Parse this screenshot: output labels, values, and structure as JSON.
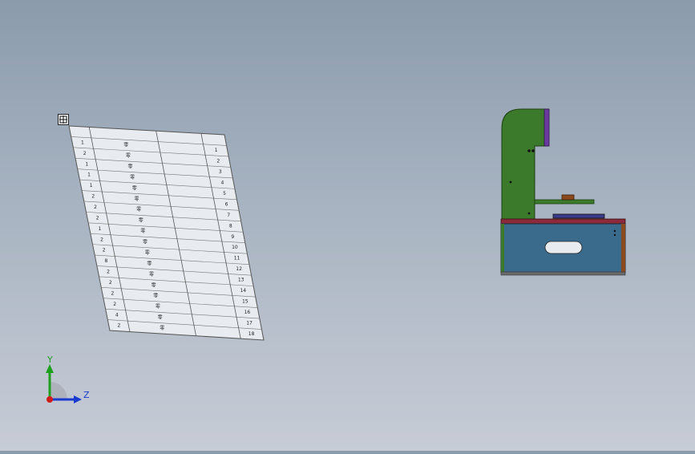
{
  "viewport": {
    "background_top": "#8b9bac",
    "background_bottom": "#c7ccd6"
  },
  "bom_table": {
    "header": [
      "",
      "",
      "",
      ""
    ],
    "rows": [
      [
        "1",
        "零",
        "",
        "1"
      ],
      [
        "2",
        "零",
        "",
        "2"
      ],
      [
        "1",
        "零",
        "",
        "3"
      ],
      [
        "1",
        "零",
        "",
        "4"
      ],
      [
        "1",
        "零",
        "",
        "5"
      ],
      [
        "2",
        "零",
        "",
        "6"
      ],
      [
        "2",
        "零",
        "",
        "7"
      ],
      [
        "2",
        "零",
        "",
        "8"
      ],
      [
        "1",
        "零",
        "",
        "9"
      ],
      [
        "2",
        "零",
        "",
        "10"
      ],
      [
        "2",
        "零",
        "",
        "11"
      ],
      [
        "8",
        "零",
        "",
        "12"
      ],
      [
        "2",
        "零",
        "",
        "13"
      ],
      [
        "2",
        "零",
        "",
        "14"
      ],
      [
        "2",
        "零",
        "",
        "15"
      ],
      [
        "2",
        "零",
        "",
        "16"
      ],
      [
        "4",
        "零",
        "",
        "17"
      ],
      [
        "2",
        "零",
        "",
        "18"
      ]
    ],
    "border_color": "#555555",
    "fill_color": "#e8ecf0"
  },
  "model": {
    "green": "#3a7a2a",
    "purple": "#6a3aa0",
    "blue": "#3a6a8c",
    "red": "#8a2a3a",
    "brown": "#8a4a1e",
    "gray": "#6a6a6a"
  },
  "triad": {
    "y_label": "Y",
    "z_label": "Z",
    "y_color": "#1ea01e",
    "z_color": "#1a3ad0",
    "x_color": "#d01a1a"
  },
  "icons": {
    "move_handle": "move-arrows-icon"
  }
}
